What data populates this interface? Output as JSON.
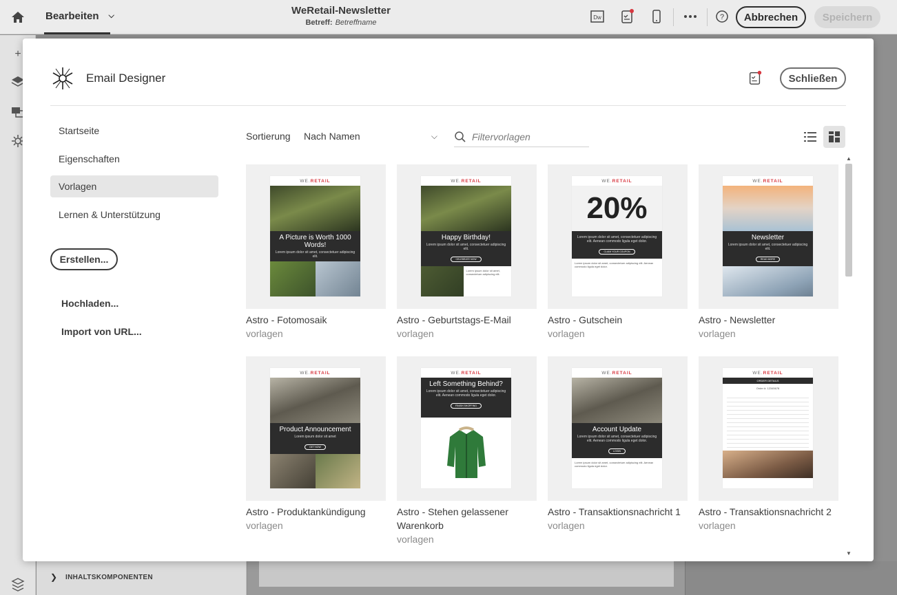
{
  "app": {
    "tab_label": "Bearbeiten",
    "doc_title": "WeRetail-Newsletter",
    "subject_label": "Betreff:",
    "subject_value": "Betreffname",
    "cancel_label": "Abbrechen",
    "save_label": "Speichern",
    "panel_label": "INHALTSKOMPONENTEN"
  },
  "modal": {
    "title": "Email Designer",
    "close_label": "Schließen",
    "nav": [
      {
        "label": "Startseite",
        "active": false
      },
      {
        "label": "Eigenschaften",
        "active": false
      },
      {
        "label": "Vorlagen",
        "active": true
      },
      {
        "label": "Lernen & Unterstützung",
        "active": false
      }
    ],
    "create_label": "Erstellen...",
    "upload_label": "Hochladen...",
    "import_label": "Import von URL...",
    "sort_label": "Sortierung",
    "sort_value": "Nach Namen",
    "filter_placeholder": "Filtervorlagen"
  },
  "templates": [
    {
      "name": "Astro - Fotomosaik",
      "type": "vorlagen",
      "brand": "WE.RETAIL",
      "headline": "A Picture is Worth 1000 Words!",
      "body": "Lorem ipsum dolor sit amet, consectetuer adipiscing elit.",
      "cta": ""
    },
    {
      "name": "Astro - Geburtstags-E-Mail",
      "type": "vorlagen",
      "brand": "WE.RETAIL",
      "headline": "Happy Birthday!",
      "body": "Lorem ipsum dolor sit amet, consectetuer adipiscing elit.",
      "cta": "CELEBRATE NOW"
    },
    {
      "name": "Astro - Gutschein",
      "type": "vorlagen",
      "brand": "WE.RETAIL",
      "headline": "20%",
      "body": "Lorem ipsum dolor sit amet, consectetuer adipiscing elit. Aenean commodo ligula eget dolor.",
      "cta": "CLAIM YOUR COUPON"
    },
    {
      "name": "Astro - Newsletter",
      "type": "vorlagen",
      "brand": "WE.RETAIL",
      "headline": "Newsletter",
      "body": "Lorem ipsum dolor sit amet, consectetuer adipiscing elit.",
      "cta": "READ MORE"
    },
    {
      "name": "Astro - Produktankündigung",
      "type": "vorlagen",
      "brand": "WE.RETAIL",
      "headline": "Product Announcement",
      "body": "Lorem ipsum dolor sit amet",
      "cta": "GET NOW"
    },
    {
      "name": "Astro - Stehen gelassener Warenkorb",
      "type": "vorlagen",
      "brand": "WE.RETAIL",
      "headline": "Left Something Behind?",
      "body": "Lorem ipsum dolor sit amet, consectetuer adipiscing elit. Aenean commodo ligula eget dolor.",
      "cta": "FINISH SHOPPING"
    },
    {
      "name": "Astro - Transaktionsnachricht 1",
      "type": "vorlagen",
      "brand": "WE.RETAIL",
      "headline": "Account Update",
      "body": "Lorem ipsum dolor sit amet, consectetuer adipiscing elit. Aenean commodo ligula eget dolor.",
      "cta": "LOGIN"
    },
    {
      "name": "Astro - Transaktionsnachricht 2",
      "type": "vorlagen",
      "brand": "WE.RETAIL",
      "headline": "ORDER DETAILS",
      "body": "Order #: 12345678",
      "cta": ""
    }
  ],
  "icons": {
    "home": "home-icon",
    "dreamweaver": "dw-icon",
    "checklist": "checklist-icon",
    "mobile": "mobile-icon",
    "more": "more-icon",
    "help": "help-icon",
    "logo": "email-designer-logo",
    "search": "search-icon",
    "list_view": "list-view-icon",
    "grid_view": "grid-view-icon"
  },
  "colors": {
    "accent_red": "#d7373f",
    "dark_band": "#2c2c2c",
    "thumb_bg": "#f0f0f0",
    "active_nav": "#e6e6e6"
  }
}
